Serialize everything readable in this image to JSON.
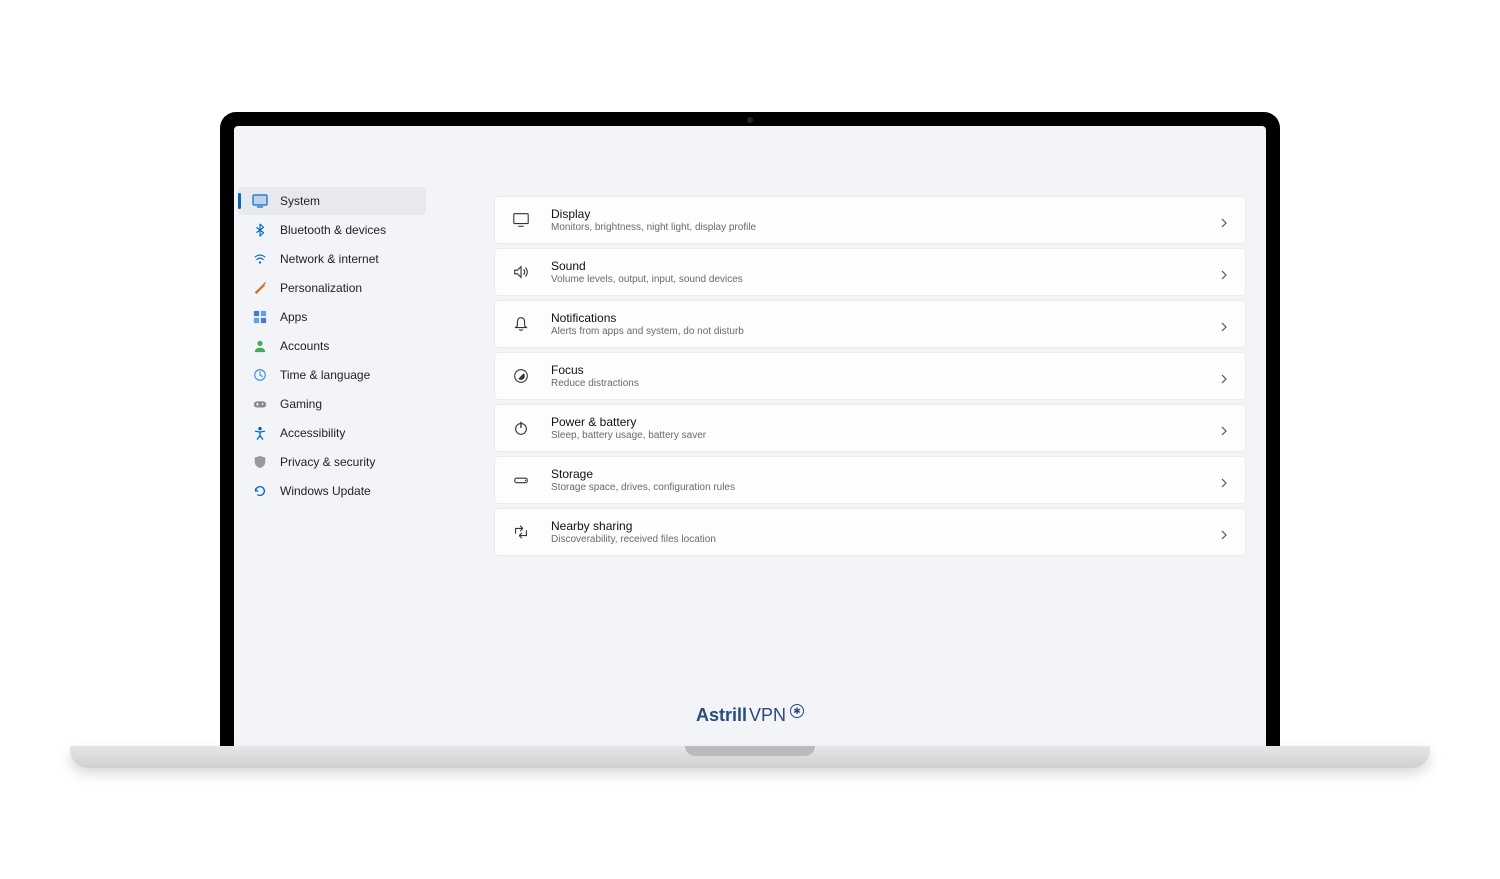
{
  "sidebar": {
    "items": [
      {
        "label": "System",
        "icon": "system",
        "active": true
      },
      {
        "label": "Bluetooth & devices",
        "icon": "bluetooth",
        "active": false
      },
      {
        "label": "Network & internet",
        "icon": "network",
        "active": false
      },
      {
        "label": "Personalization",
        "icon": "personalization",
        "active": false
      },
      {
        "label": "Apps",
        "icon": "apps",
        "active": false
      },
      {
        "label": "Accounts",
        "icon": "accounts",
        "active": false
      },
      {
        "label": "Time & language",
        "icon": "time",
        "active": false
      },
      {
        "label": "Gaming",
        "icon": "gaming",
        "active": false
      },
      {
        "label": "Accessibility",
        "icon": "accessibility",
        "active": false
      },
      {
        "label": "Privacy & security",
        "icon": "privacy",
        "active": false
      },
      {
        "label": "Windows Update",
        "icon": "update",
        "active": false
      }
    ]
  },
  "main": {
    "cards": [
      {
        "title": "Display",
        "desc": "Monitors, brightness, night light, display profile",
        "icon": "display"
      },
      {
        "title": "Sound",
        "desc": "Volume levels, output, input, sound devices",
        "icon": "sound"
      },
      {
        "title": "Notifications",
        "desc": "Alerts from apps and system, do not disturb",
        "icon": "notifications"
      },
      {
        "title": "Focus",
        "desc": "Reduce distractions",
        "icon": "focus"
      },
      {
        "title": "Power & battery",
        "desc": "Sleep, battery usage, battery saver",
        "icon": "power"
      },
      {
        "title": "Storage",
        "desc": "Storage space, drives, configuration rules",
        "icon": "storage"
      },
      {
        "title": "Nearby sharing",
        "desc": "Discoverability, received files location",
        "icon": "nearby"
      }
    ]
  },
  "watermark": {
    "part1": "Astrill",
    "part2": "VPN"
  }
}
